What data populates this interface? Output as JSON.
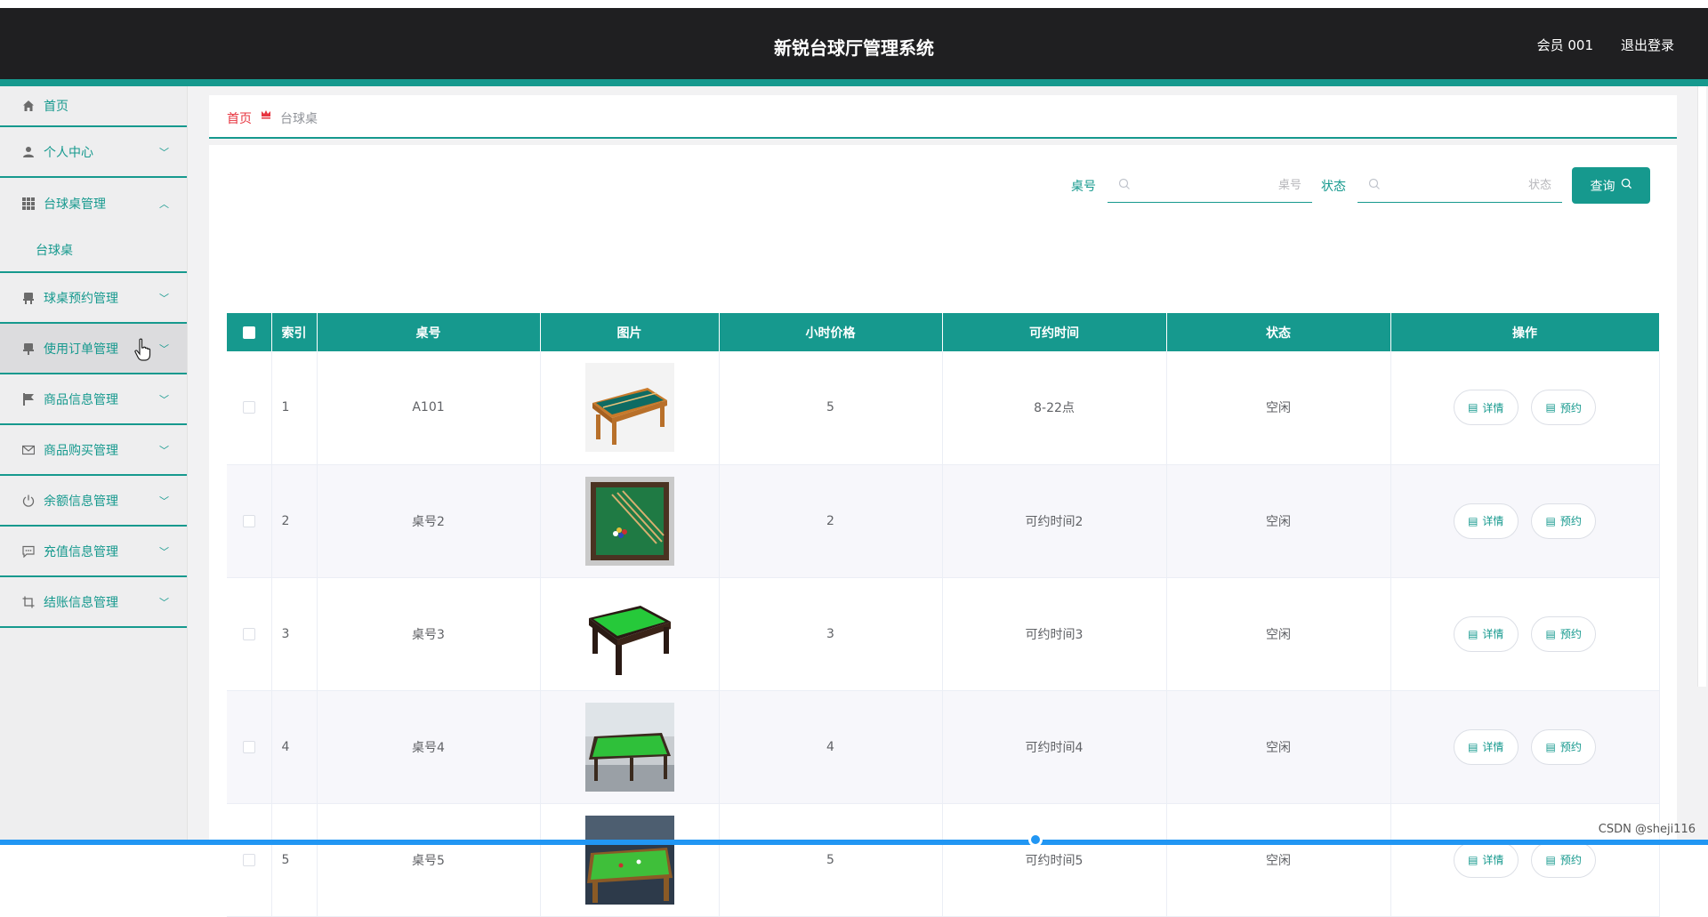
{
  "header": {
    "title": "新锐台球厅管理系统",
    "user": "会员 001",
    "logout": "退出登录"
  },
  "sidebar": {
    "items": [
      {
        "label": "首页",
        "icon": "home-icon"
      },
      {
        "label": "个人中心",
        "icon": "user-icon"
      },
      {
        "label": "台球桌管理",
        "icon": "grid-icon"
      },
      {
        "label": "球桌预约管理",
        "icon": "chair-icon"
      },
      {
        "label": "使用订单管理",
        "icon": "chair-icon"
      },
      {
        "label": "商品信息管理",
        "icon": "flag-icon"
      },
      {
        "label": "商品购买管理",
        "icon": "mail-icon"
      },
      {
        "label": "余额信息管理",
        "icon": "power-icon"
      },
      {
        "label": "充值信息管理",
        "icon": "chat-icon"
      },
      {
        "label": "结账信息管理",
        "icon": "crop-icon"
      }
    ],
    "submenu_label": "台球桌"
  },
  "breadcrumb": {
    "home": "首页",
    "current": "台球桌"
  },
  "search": {
    "table_no_label": "桌号",
    "table_no_placeholder": "桌号",
    "status_label": "状态",
    "status_placeholder": "状态",
    "query_button": "查询"
  },
  "table": {
    "headers": [
      "索引",
      "桌号",
      "图片",
      "小时价格",
      "可约时间",
      "状态",
      "操作"
    ],
    "rows": [
      {
        "index": "1",
        "no": "A101",
        "price": "5",
        "time": "8-22点",
        "status": "空闲"
      },
      {
        "index": "2",
        "no": "桌号2",
        "price": "2",
        "time": "可约时间2",
        "status": "空闲"
      },
      {
        "index": "3",
        "no": "桌号3",
        "price": "3",
        "time": "可约时间3",
        "status": "空闲"
      },
      {
        "index": "4",
        "no": "桌号4",
        "price": "4",
        "time": "可约时间4",
        "status": "空闲"
      },
      {
        "index": "5",
        "no": "桌号5",
        "price": "5",
        "time": "可约时间5",
        "status": "空闲"
      }
    ],
    "detail_button": "详情",
    "reserve_button": "预约"
  },
  "watermark": "CSDN @sheji116",
  "colors": {
    "primary": "#16998e",
    "header_bg": "#1f1f21",
    "breadcrumb_home": "#e7343f"
  }
}
